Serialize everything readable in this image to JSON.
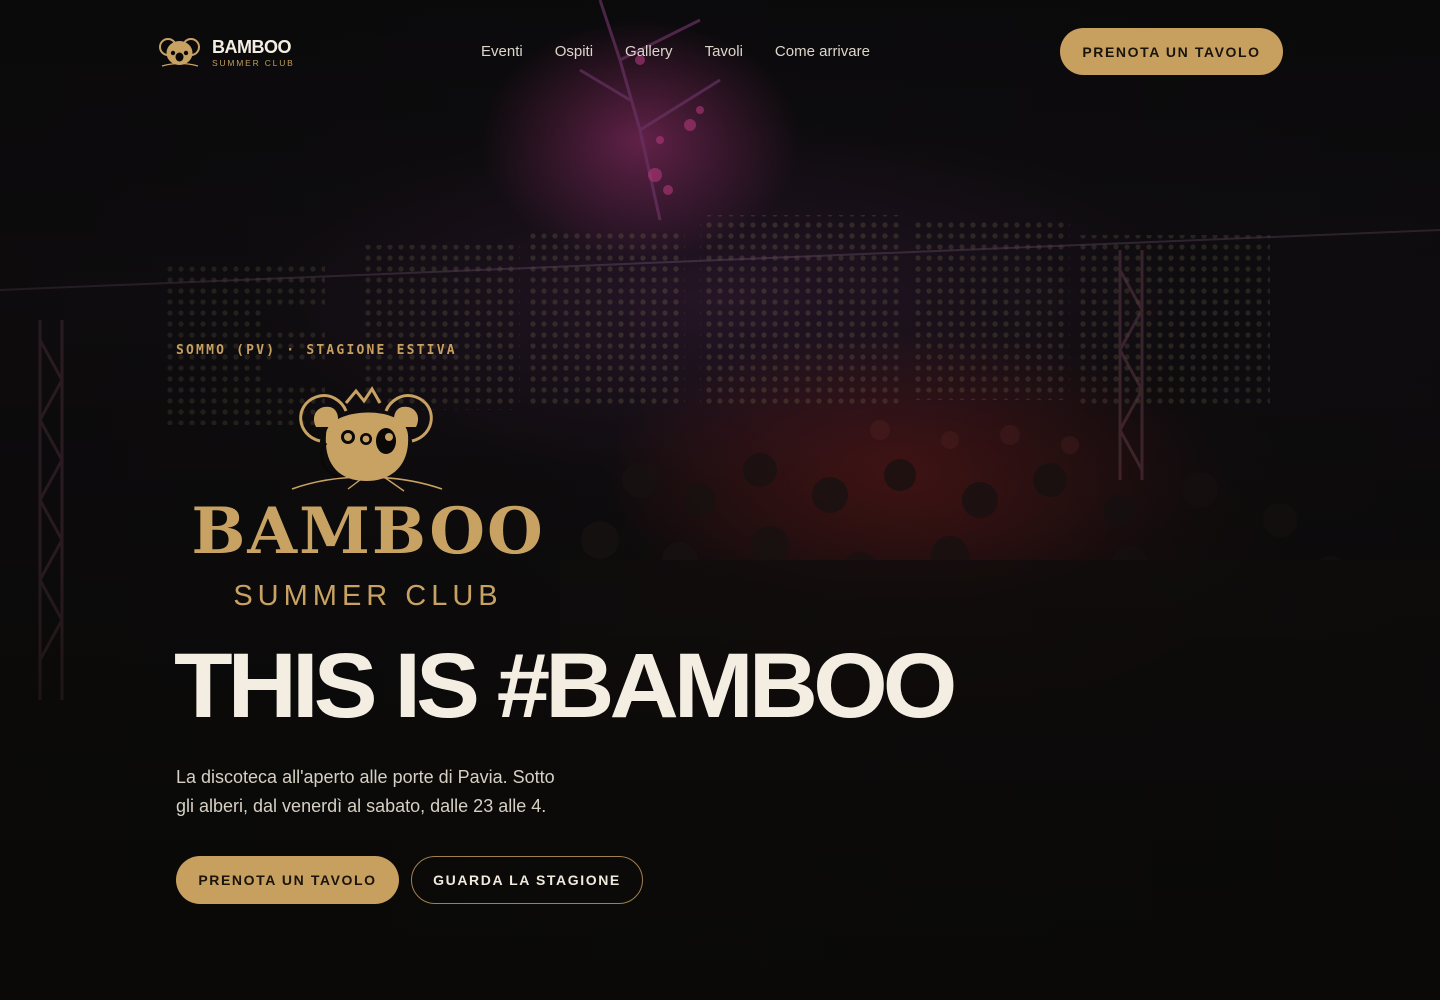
{
  "brand": {
    "name": "BAMBOO",
    "subtitle": "SUMMER CLUB",
    "icon": "koala-logo-icon"
  },
  "nav": {
    "links": [
      "Eventi",
      "Ospiti",
      "Gallery",
      "Tavoli",
      "Come arrivare"
    ],
    "cta_label": "PRENOTA UN TAVOLO"
  },
  "hero": {
    "eyebrow": "SOMMO (PV) · STAGIONE ESTIVA",
    "logo_name": "BAMBOO",
    "logo_subtitle": "SUMMER CLUB",
    "logo_icon": "koala-logo-icon",
    "headline": "THIS IS #BAMBOO",
    "lead": "La discoteca all'aperto alle porte di Pavia. Sotto gli alberi, dal venerdì al sabato, dalle 23 alle 4.",
    "primary_button": "PRENOTA UN TAVOLO",
    "secondary_button": "GUARDA LA STAGIONE"
  },
  "colors": {
    "accent_gold": "#c7a060",
    "text_light": "#f3ede2",
    "background": "#0a0908"
  }
}
